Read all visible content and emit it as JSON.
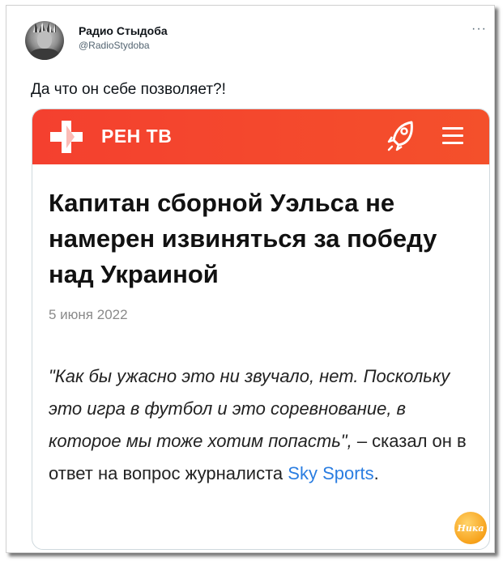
{
  "tweet": {
    "author_name": "Радио Стыдоба",
    "author_handle": "@RadioStydoba",
    "more_glyph": "···",
    "text": "Да что он себе позволяет?!"
  },
  "card": {
    "brand": "РЕН ТВ",
    "brand_color": "#f4402f",
    "header_icons": [
      "rocket-icon",
      "menu-icon"
    ],
    "headline": "Капитан сборной Уэльса не намерен извиняться за победу над Украиной",
    "date": "5 июня 2022",
    "quote_italic": "\"Как бы ужасно это ни звучало, нет. Поскольку это игра в футбол и это соревнование, в которое мы тоже хотим попасть\",",
    "quote_plain": " – сказал он в ответ на вопрос журналиста ",
    "quote_link": "Sky Sports",
    "quote_end": ".",
    "link_color": "#2a7de1"
  },
  "watermark": {
    "text": "Ника"
  }
}
